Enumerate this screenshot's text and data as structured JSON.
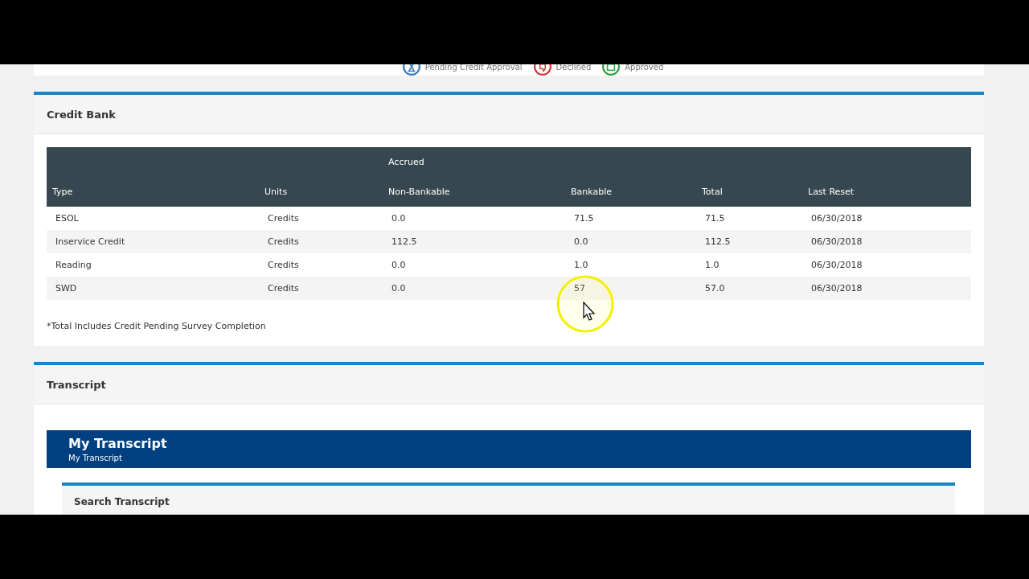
{
  "legend": [
    {
      "kind": "pending",
      "label": "Pending Credit Approval",
      "color": "#3a7ab8"
    },
    {
      "kind": "declined",
      "label": "Declined",
      "color": "#d0393e"
    },
    {
      "kind": "approved",
      "label": "Approved",
      "color": "#2e9e3e"
    }
  ],
  "credit_bank": {
    "title": "Credit Bank",
    "group_header": "Accrued",
    "columns": [
      "Type",
      "Units",
      "Non-Bankable",
      "Bankable",
      "Total",
      "Last Reset"
    ],
    "rows": [
      [
        "ESOL",
        "Credits",
        "0.0",
        "71.5",
        "71.5",
        "06/30/2018"
      ],
      [
        "Inservice Credit",
        "Credits",
        "112.5",
        "0.0",
        "112.5",
        "06/30/2018"
      ],
      [
        "Reading",
        "Credits",
        "0.0",
        "1.0",
        "1.0",
        "06/30/2018"
      ],
      [
        "SWD",
        "Credits",
        "0.0",
        "57",
        "57.0",
        "06/30/2018"
      ]
    ],
    "footnote": "*Total Includes Credit Pending Survey Completion"
  },
  "transcript": {
    "title": "Transcript",
    "banner_title": "My Transcript",
    "banner_subtitle": "My Transcript",
    "search_title": "Search Transcript"
  }
}
